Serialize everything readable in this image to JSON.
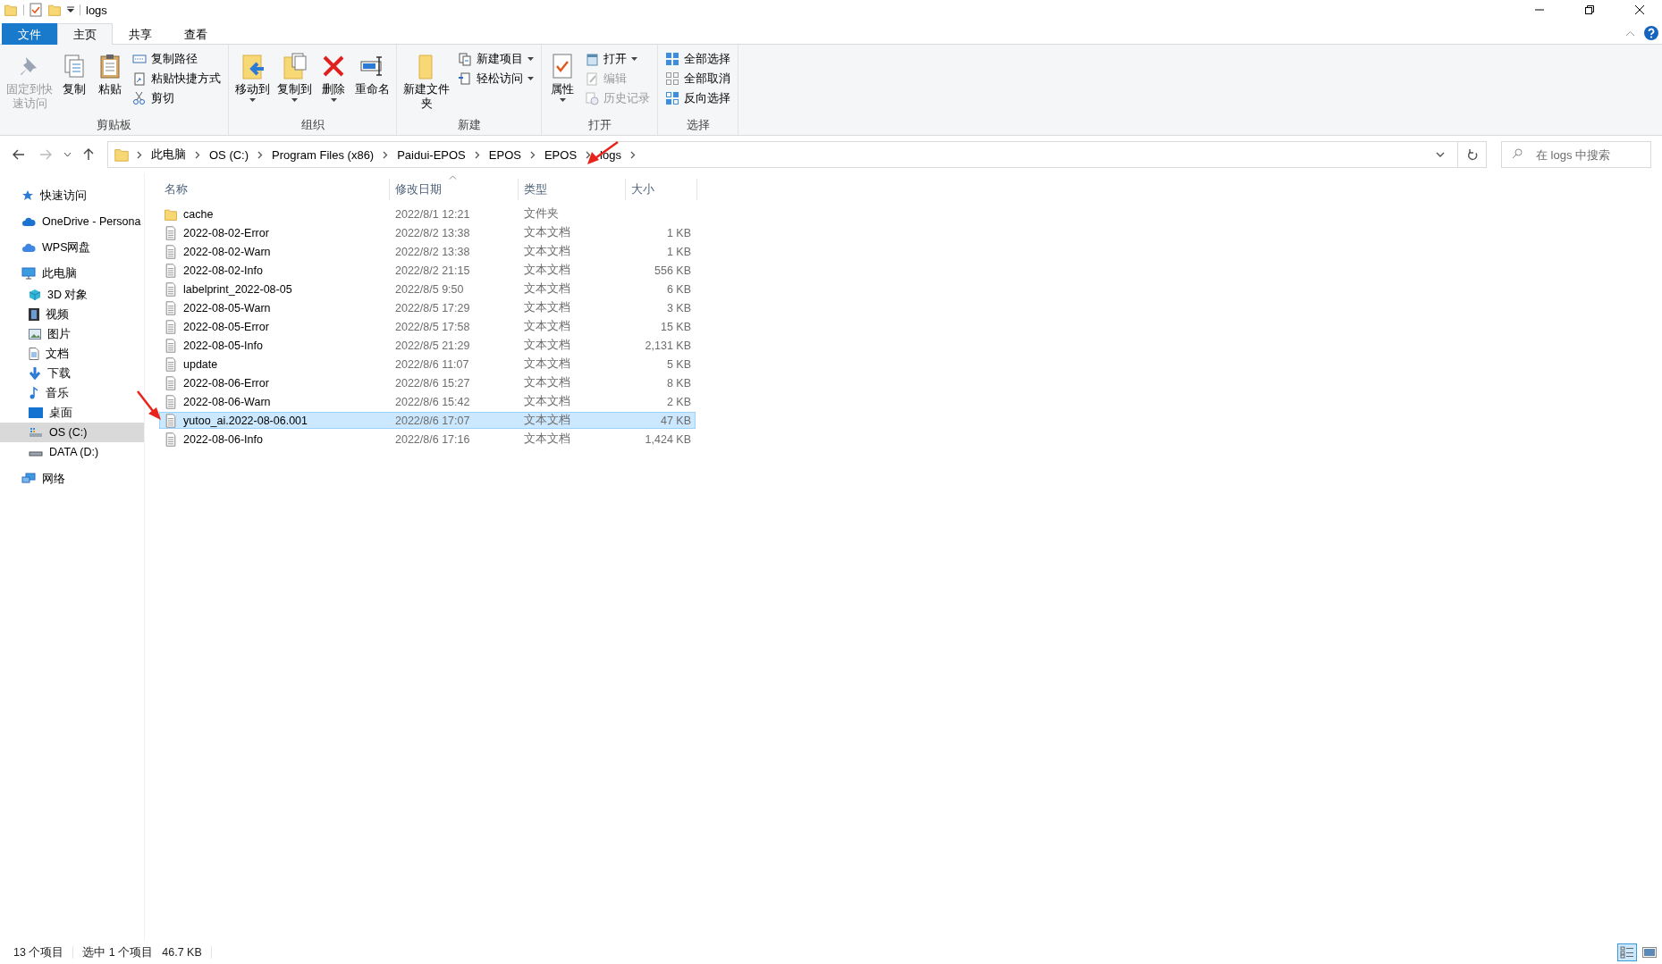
{
  "window": {
    "title": "logs"
  },
  "ribbon": {
    "tabs": [
      {
        "label": "文件",
        "kind": "file",
        "selected": false
      },
      {
        "label": "主页",
        "kind": "tab",
        "selected": true
      },
      {
        "label": "共享",
        "kind": "tab",
        "selected": false
      },
      {
        "label": "查看",
        "kind": "tab",
        "selected": false
      }
    ],
    "groups": [
      {
        "label": "剪贴板",
        "commands": [
          {
            "label": "固定到快速访问",
            "kind": "large",
            "disabled": true,
            "dropdown": false
          },
          {
            "label": "复制",
            "kind": "large",
            "disabled": false,
            "dropdown": false
          },
          {
            "label": "粘贴",
            "kind": "large",
            "disabled": false,
            "dropdown": false
          },
          {
            "label": "复制路径",
            "kind": "small",
            "disabled": false,
            "dropdown": false
          },
          {
            "label": "粘贴快捷方式",
            "kind": "small",
            "disabled": false,
            "dropdown": false
          },
          {
            "label": "剪切",
            "kind": "small",
            "disabled": false,
            "dropdown": false
          }
        ]
      },
      {
        "label": "组织",
        "commands": [
          {
            "label": "移动到",
            "kind": "large",
            "disabled": false,
            "dropdown": true
          },
          {
            "label": "复制到",
            "kind": "large",
            "disabled": false,
            "dropdown": true
          },
          {
            "label": "删除",
            "kind": "large",
            "disabled": false,
            "dropdown": true
          },
          {
            "label": "重命名",
            "kind": "large",
            "disabled": false,
            "dropdown": false
          }
        ]
      },
      {
        "label": "新建",
        "commands": [
          {
            "label": "新建文件夹",
            "kind": "large",
            "disabled": false,
            "dropdown": false
          },
          {
            "label": "新建项目",
            "kind": "small",
            "disabled": false,
            "dropdown": true
          },
          {
            "label": "轻松访问",
            "kind": "small",
            "disabled": false,
            "dropdown": true
          }
        ]
      },
      {
        "label": "打开",
        "commands": [
          {
            "label": "属性",
            "kind": "large",
            "disabled": false,
            "dropdown": true
          },
          {
            "label": "打开",
            "kind": "small",
            "disabled": false,
            "dropdown": true
          },
          {
            "label": "编辑",
            "kind": "small",
            "disabled": true,
            "dropdown": false
          },
          {
            "label": "历史记录",
            "kind": "small",
            "disabled": true,
            "dropdown": false
          }
        ]
      },
      {
        "label": "选择",
        "commands": [
          {
            "label": "全部选择",
            "kind": "small",
            "disabled": false,
            "dropdown": false
          },
          {
            "label": "全部取消",
            "kind": "small",
            "disabled": false,
            "dropdown": false
          },
          {
            "label": "反向选择",
            "kind": "small",
            "disabled": false,
            "dropdown": false
          }
        ]
      }
    ]
  },
  "address_bar": {
    "back_disabled": false,
    "forward_disabled": true,
    "path": [
      "此电脑",
      "OS (C:)",
      "Program Files (x86)",
      "Paidui-EPOS",
      "EPOS",
      "EPOS",
      "logs"
    ]
  },
  "search": {
    "placeholder": "在 logs 中搜索"
  },
  "sidebar": {
    "items": [
      {
        "label": "快速访问",
        "kind": "quick",
        "selected": false
      },
      {
        "label": "OneDrive - Persona",
        "kind": "cloud",
        "selected": false
      },
      {
        "label": "WPS网盘",
        "kind": "wps",
        "selected": false
      },
      {
        "label": "此电脑",
        "kind": "pc",
        "selected": false,
        "children": [
          {
            "label": "3D 对象",
            "kind": "cube",
            "selected": false
          },
          {
            "label": "视频",
            "kind": "video",
            "selected": false
          },
          {
            "label": "图片",
            "kind": "picture",
            "selected": false
          },
          {
            "label": "文档",
            "kind": "doc",
            "selected": false
          },
          {
            "label": "下载",
            "kind": "download",
            "selected": false
          },
          {
            "label": "音乐",
            "kind": "music",
            "selected": false
          },
          {
            "label": "桌面",
            "kind": "desktop",
            "selected": false
          },
          {
            "label": "OS (C:)",
            "kind": "drive",
            "selected": true
          },
          {
            "label": "DATA (D:)",
            "kind": "drive2",
            "selected": false
          }
        ]
      },
      {
        "label": "网络",
        "kind": "network",
        "selected": false
      }
    ]
  },
  "table": {
    "columns": [
      {
        "label": "名称",
        "sorted": false
      },
      {
        "label": "修改日期",
        "sorted": true
      },
      {
        "label": "类型",
        "sorted": false
      },
      {
        "label": "大小",
        "sorted": false
      }
    ],
    "rows": [
      {
        "name": "cache",
        "date": "2022/8/1 12:21",
        "type": "文件夹",
        "size": "",
        "kind": "folder",
        "selected": false
      },
      {
        "name": "2022-08-02-Error",
        "date": "2022/8/2 13:38",
        "type": "文本文档",
        "size": "1 KB",
        "kind": "file",
        "selected": false
      },
      {
        "name": "2022-08-02-Warn",
        "date": "2022/8/2 13:38",
        "type": "文本文档",
        "size": "1 KB",
        "kind": "file",
        "selected": false
      },
      {
        "name": "2022-08-02-Info",
        "date": "2022/8/2 21:15",
        "type": "文本文档",
        "size": "556 KB",
        "kind": "file",
        "selected": false
      },
      {
        "name": "labelprint_2022-08-05",
        "date": "2022/8/5 9:50",
        "type": "文本文档",
        "size": "6 KB",
        "kind": "file",
        "selected": false
      },
      {
        "name": "2022-08-05-Warn",
        "date": "2022/8/5 17:29",
        "type": "文本文档",
        "size": "3 KB",
        "kind": "file",
        "selected": false
      },
      {
        "name": "2022-08-05-Error",
        "date": "2022/8/5 17:58",
        "type": "文本文档",
        "size": "15 KB",
        "kind": "file",
        "selected": false
      },
      {
        "name": "2022-08-05-Info",
        "date": "2022/8/5 21:29",
        "type": "文本文档",
        "size": "2,131 KB",
        "kind": "file",
        "selected": false
      },
      {
        "name": "update",
        "date": "2022/8/6 11:07",
        "type": "文本文档",
        "size": "5 KB",
        "kind": "file",
        "selected": false
      },
      {
        "name": "2022-08-06-Error",
        "date": "2022/8/6 15:27",
        "type": "文本文档",
        "size": "8 KB",
        "kind": "file",
        "selected": false
      },
      {
        "name": "2022-08-06-Warn",
        "date": "2022/8/6 15:42",
        "type": "文本文档",
        "size": "2 KB",
        "kind": "file",
        "selected": false
      },
      {
        "name": "yutoo_ai.2022-08-06.001",
        "date": "2022/8/6 17:07",
        "type": "文本文档",
        "size": "47 KB",
        "kind": "file",
        "selected": true
      },
      {
        "name": "2022-08-06-Info",
        "date": "2022/8/6 17:16",
        "type": "文本文档",
        "size": "1,424 KB",
        "kind": "file",
        "selected": false
      }
    ]
  },
  "status_bar": {
    "item_count": "13 个项目",
    "selection": "选中 1 个项目",
    "selection_size": "46.7 KB",
    "view_modes": [
      {
        "kind": "details",
        "selected": true
      },
      {
        "kind": "large_icons",
        "selected": false
      }
    ]
  }
}
